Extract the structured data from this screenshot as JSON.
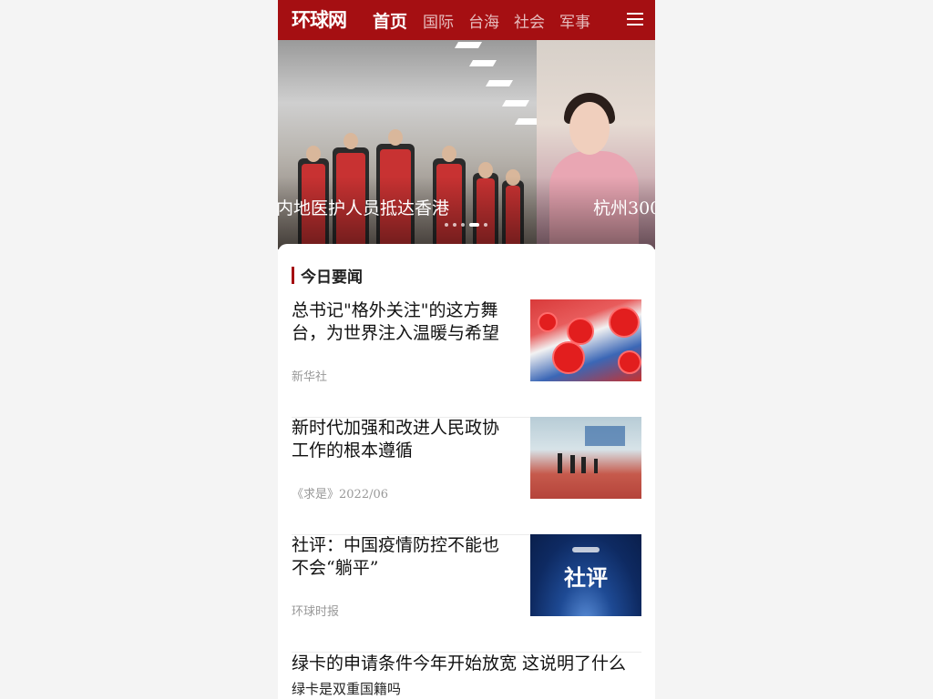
{
  "header": {
    "logo": "环球网",
    "tabs": [
      {
        "label": "首页",
        "active": true
      },
      {
        "label": "国际",
        "active": false
      },
      {
        "label": "台海",
        "active": false
      },
      {
        "label": "社会",
        "active": false
      },
      {
        "label": "军事",
        "active": false
      }
    ],
    "menu_icon": "hamburger-menu-icon",
    "background_color": "#a50f12"
  },
  "carousel": {
    "slides": [
      {
        "caption": "内地医护人员抵达香港"
      },
      {
        "caption": "杭州300"
      }
    ],
    "dot_count": 5,
    "active_dot": 3
  },
  "section": {
    "title": "今日要闻",
    "accent_color": "#a50f12"
  },
  "news": [
    {
      "title": "总书记\"格外关注\"的这方舞台，为世界注入温暖与希望",
      "source": "新华社"
    },
    {
      "title": "新时代加强和改进人民政协工作的根本遵循",
      "source": "《求是》2022/06"
    },
    {
      "title": "社评：中国疫情防控不能也不会“躺平”",
      "source": "环球时报",
      "thumb_label": "社评"
    }
  ],
  "text_item": {
    "title": "绿卡的申请条件今年开始放宽 这说明了什么",
    "subtitle": "绿卡是双重国籍吗"
  }
}
